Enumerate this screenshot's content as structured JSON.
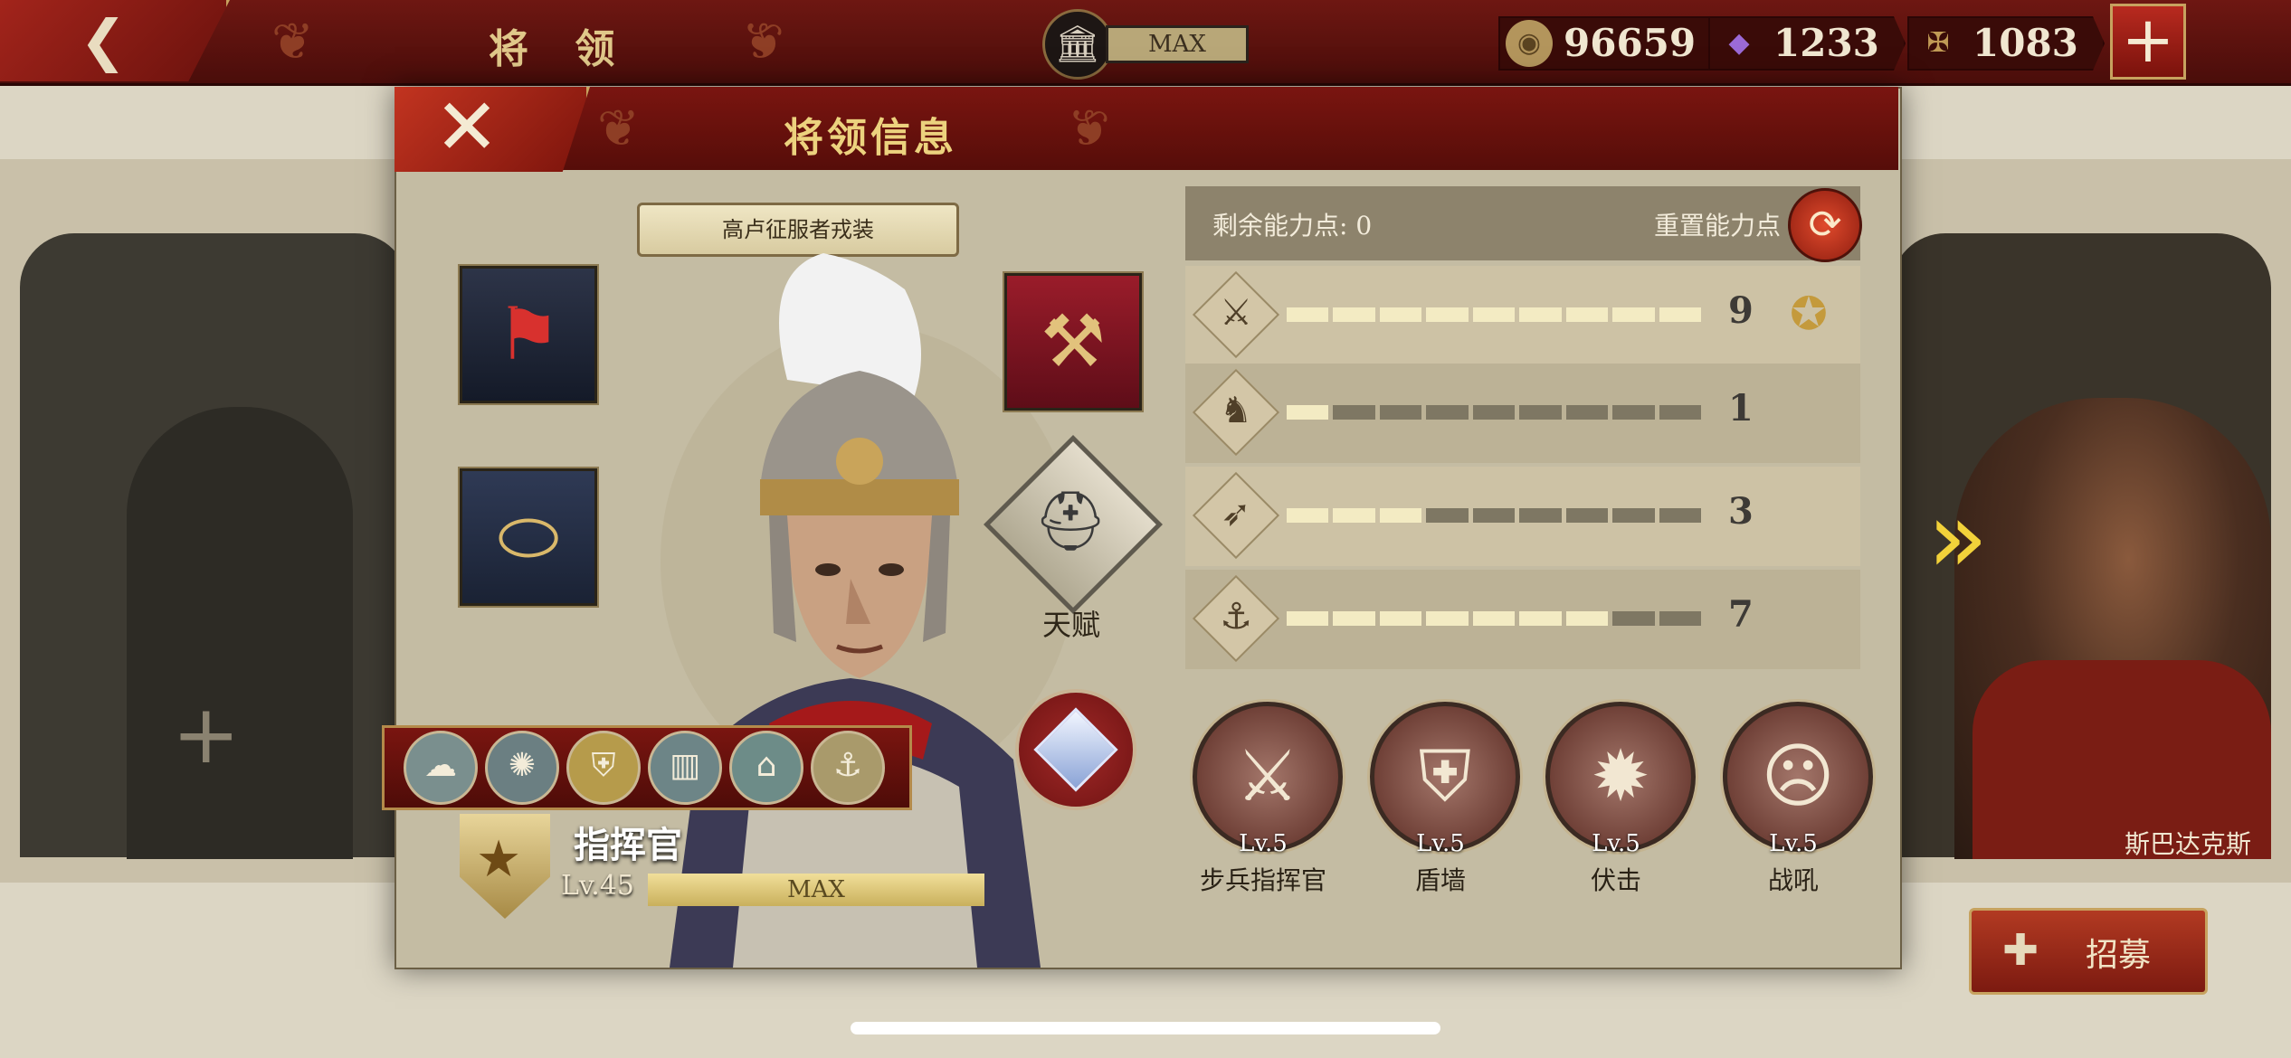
{
  "topbar": {
    "back_icon": "chevron-left-icon",
    "title": "将 领",
    "building_level": "MAX",
    "resources": [
      {
        "name": "coin",
        "icon": "coin-icon",
        "value": "96659",
        "color": "#b3955c"
      },
      {
        "name": "gem",
        "icon": "purple-gem-icon",
        "value": "1233",
        "color": "#7b4ab8"
      },
      {
        "name": "spqr",
        "icon": "spqr-eagle-icon",
        "value": "1083",
        "color": "#c09a55"
      }
    ],
    "add_label": "+"
  },
  "dialog": {
    "title": "将领信息",
    "close_label": "✕",
    "costume_label": "高卢征服者戎装",
    "talent_label": "天赋",
    "rank_title": "指挥官",
    "level": "Lv.45",
    "xp_label": "MAX",
    "medals": [
      "medal-1",
      "medal-2",
      "medal-3",
      "medal-4",
      "medal-5",
      "medal-6"
    ],
    "points": {
      "label": "剩余能力点: 0",
      "reset_label": "重置能力点"
    },
    "stats": [
      {
        "name": "infantry",
        "icon": "sword-icon",
        "value": 9,
        "max": 9,
        "badge": "star-laurel-icon"
      },
      {
        "name": "cavalry",
        "icon": "horse-icon",
        "value": 1,
        "max": 9
      },
      {
        "name": "archery",
        "icon": "bow-icon",
        "value": 3,
        "max": 9
      },
      {
        "name": "navy",
        "icon": "anchor-icon",
        "value": 7,
        "max": 9
      }
    ],
    "skills": [
      {
        "icon": "crossed-swords-icon",
        "level": "Lv.5",
        "name": "步兵指挥官"
      },
      {
        "icon": "shield-wall-icon",
        "level": "Lv.5",
        "name": "盾墙"
      },
      {
        "icon": "ambush-icon",
        "level": "Lv.5",
        "name": "伏击"
      },
      {
        "icon": "war-cry-icon",
        "level": "Lv.5",
        "name": "战吼"
      }
    ]
  },
  "background": {
    "right_hero_name": "斯巴达克斯",
    "recruit_label": "招募",
    "empty_slot_label": "+"
  }
}
